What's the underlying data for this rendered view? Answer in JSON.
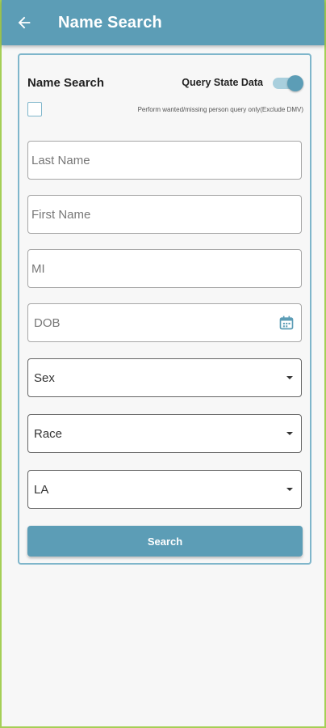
{
  "appbar": {
    "title": "Name Search",
    "back_icon": "arrow-left-icon",
    "color": "#5c9db6"
  },
  "form": {
    "section_title": "Name Search",
    "toggle_label": "Query State Data",
    "toggle_on": true,
    "checkbox_label": "Perform wanted/missing person query only(Exclude DMV)",
    "checkbox_checked": false,
    "fields": {
      "last_name_placeholder": "Last Name",
      "first_name_placeholder": "First Name",
      "mi_placeholder": "MI",
      "dob_placeholder": "DOB",
      "sex_value": "Sex",
      "race_value": "Race",
      "state_value": "LA"
    },
    "search_button": "Search"
  }
}
